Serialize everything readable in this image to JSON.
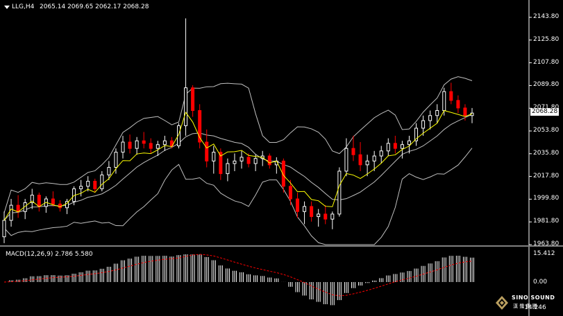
{
  "header": {
    "symbol": "LLG,H4",
    "ohlc": "2065.14 2069.65 2062.17 2068.28"
  },
  "price_axis": {
    "labels": [
      "2143.80",
      "2125.80",
      "2107.80",
      "2089.80",
      "2071.80",
      "2053.80",
      "2035.80",
      "2017.80",
      "1999.80",
      "1981.80",
      "1963.80"
    ],
    "current_price": "2068.28"
  },
  "macd": {
    "label": "MACD(12,26,9) 2.786 5.580",
    "axis_labels": [
      "15.412",
      "0.00",
      "-14.246"
    ]
  },
  "logo": {
    "brand": "SINO SOUND",
    "sub": "漢 聲 集 團"
  },
  "colors": {
    "bull_candle": "#ffffff",
    "bear_candle": "#ff0000",
    "ma_line": "#ffff00",
    "bollinger": "#c0c0c0",
    "signal_line": "#ff0000"
  },
  "chart_data": {
    "type": "line",
    "ylim": [
      1963.8,
      2143.8
    ],
    "ohlc": [
      [
        1970,
        1990,
        1965,
        1983
      ],
      [
        1983,
        2000,
        1978,
        1995
      ],
      [
        1995,
        2003,
        1985,
        1990
      ],
      [
        1990,
        2000,
        1984,
        1997
      ],
      [
        1997,
        2008,
        1992,
        2003
      ],
      [
        2003,
        2005,
        1990,
        1994
      ],
      [
        1994,
        2002,
        1989,
        2000
      ],
      [
        2000,
        2006,
        1994,
        1996
      ],
      [
        1996,
        1999,
        1990,
        1993
      ],
      [
        1993,
        2000,
        1988,
        1998
      ],
      [
        1998,
        2010,
        1995,
        2008
      ],
      [
        2008,
        2015,
        2002,
        2010
      ],
      [
        2010,
        2018,
        2006,
        2014
      ],
      [
        2014,
        2016,
        2005,
        2008
      ],
      [
        2008,
        2022,
        2006,
        2019
      ],
      [
        2019,
        2030,
        2015,
        2025
      ],
      [
        2025,
        2040,
        2020,
        2037
      ],
      [
        2037,
        2050,
        2032,
        2045
      ],
      [
        2045,
        2051,
        2036,
        2040
      ],
      [
        2040,
        2049,
        2035,
        2046
      ],
      [
        2046,
        2053,
        2040,
        2044
      ],
      [
        2044,
        2048,
        2036,
        2040
      ],
      [
        2040,
        2046,
        2034,
        2043
      ],
      [
        2043,
        2050,
        2038,
        2046
      ],
      [
        2046,
        2049,
        2040,
        2042
      ],
      [
        2042,
        2060,
        2040,
        2058
      ],
      [
        2058,
        2143,
        2050,
        2088
      ],
      [
        2088,
        2090,
        2065,
        2070
      ],
      [
        2070,
        2075,
        2040,
        2045
      ],
      [
        2045,
        2055,
        2025,
        2030
      ],
      [
        2030,
        2042,
        2020,
        2037
      ],
      [
        2037,
        2040,
        2015,
        2020
      ],
      [
        2020,
        2032,
        2014,
        2028
      ],
      [
        2028,
        2036,
        2022,
        2030
      ],
      [
        2030,
        2038,
        2024,
        2033
      ],
      [
        2033,
        2036,
        2025,
        2028
      ],
      [
        2028,
        2035,
        2022,
        2032
      ],
      [
        2032,
        2038,
        2026,
        2034
      ],
      [
        2034,
        2036,
        2024,
        2027
      ],
      [
        2027,
        2033,
        2020,
        2030
      ],
      [
        2030,
        2032,
        2005,
        2010
      ],
      [
        2010,
        2015,
        1995,
        2000
      ],
      [
        2000,
        2005,
        1985,
        1990
      ],
      [
        1990,
        1998,
        1980,
        1994
      ],
      [
        1994,
        1998,
        1982,
        1986
      ],
      [
        1986,
        1992,
        1978,
        1988
      ],
      [
        1988,
        1995,
        1980,
        1984
      ],
      [
        1984,
        1990,
        1976,
        1988
      ],
      [
        1988,
        2025,
        1986,
        2022
      ],
      [
        2022,
        2048,
        2018,
        2040
      ],
      [
        2040,
        2050,
        2030,
        2035
      ],
      [
        2035,
        2045,
        2022,
        2027
      ],
      [
        2027,
        2035,
        2018,
        2030
      ],
      [
        2030,
        2038,
        2022,
        2034
      ],
      [
        2034,
        2042,
        2028,
        2038
      ],
      [
        2038,
        2048,
        2034,
        2044
      ],
      [
        2044,
        2050,
        2036,
        2040
      ],
      [
        2040,
        2046,
        2032,
        2043
      ],
      [
        2043,
        2050,
        2036,
        2046
      ],
      [
        2046,
        2060,
        2042,
        2056
      ],
      [
        2056,
        2066,
        2050,
        2062
      ],
      [
        2062,
        2070,
        2055,
        2066
      ],
      [
        2066,
        2075,
        2060,
        2070
      ],
      [
        2070,
        2088,
        2066,
        2085
      ],
      [
        2085,
        2092,
        2075,
        2078
      ],
      [
        2078,
        2082,
        2068,
        2072
      ],
      [
        2072,
        2075,
        2062,
        2066
      ],
      [
        2066,
        2072,
        2060,
        2068
      ]
    ]
  }
}
